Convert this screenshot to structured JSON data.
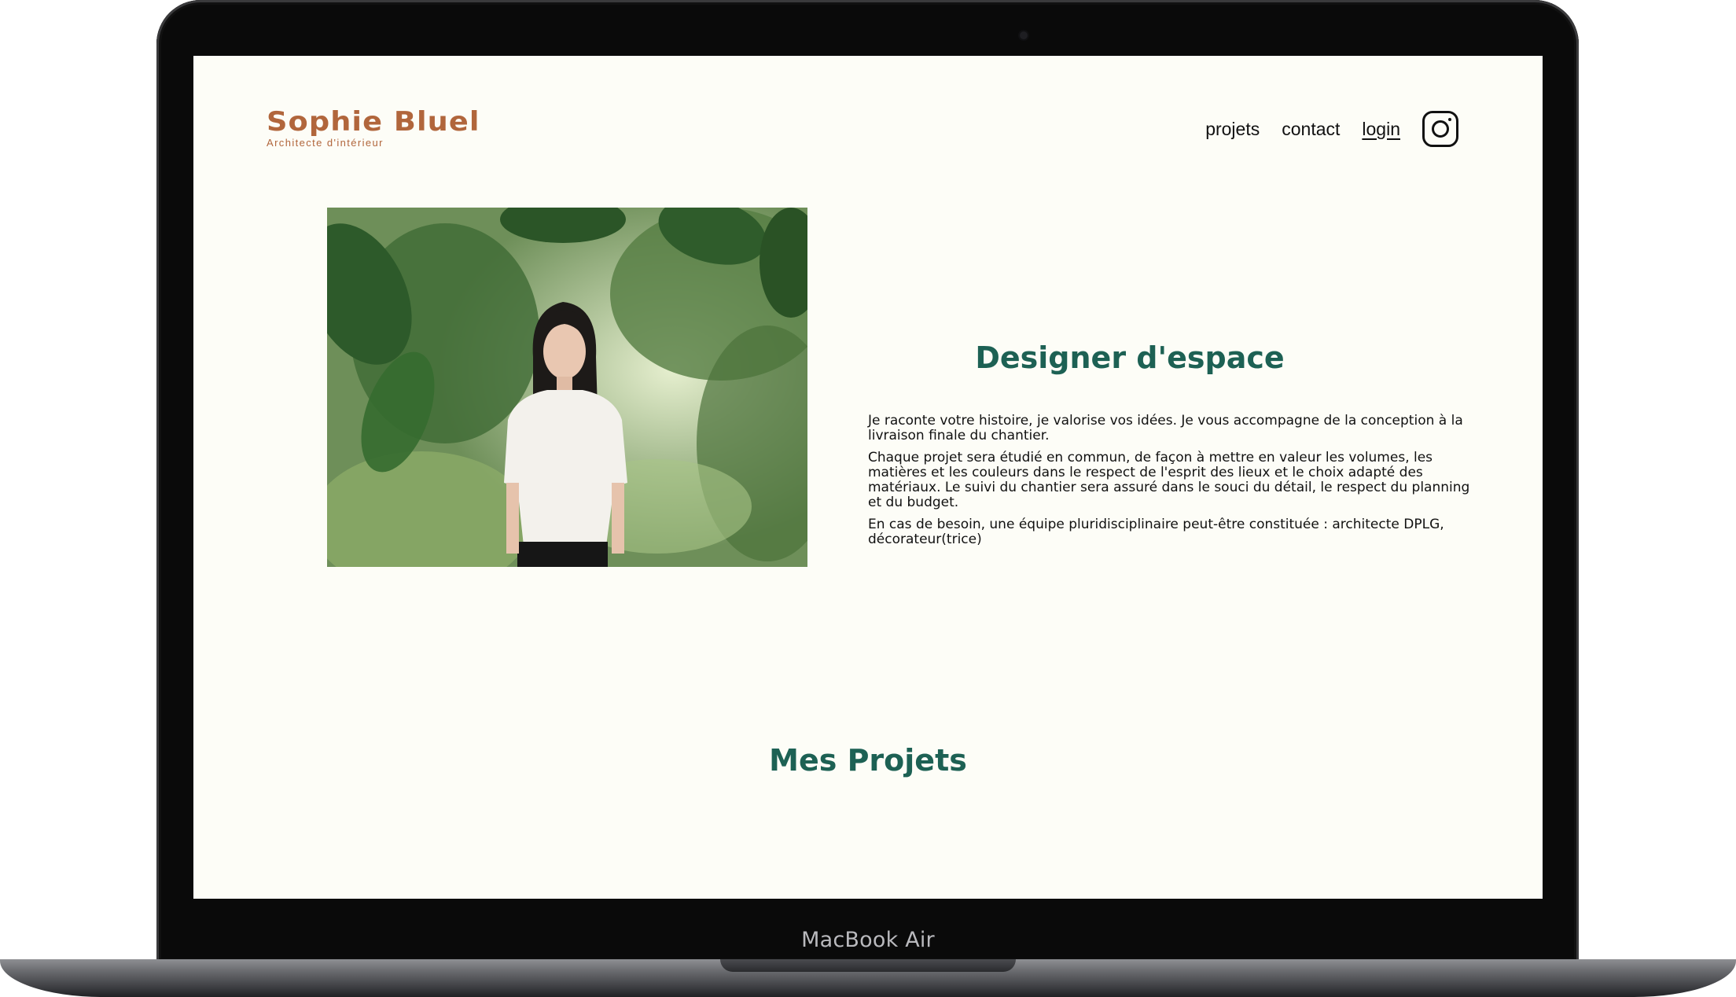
{
  "device": {
    "label": "MacBook Air"
  },
  "header": {
    "logo_title": "Sophie Bluel",
    "logo_subtitle": "Architecte d'intérieur",
    "nav": {
      "projects": "projets",
      "contact": "contact",
      "login": "login"
    },
    "social_icon": "instagram-icon"
  },
  "intro": {
    "title": "Designer d'espace",
    "paragraphs": [
      "Je raconte votre histoire, je valorise vos idées. Je vous accompagne de la conception à la livraison finale du chantier.",
      "Chaque projet sera étudié en commun, de façon à mettre en valeur les volumes, les matières et les couleurs dans le respect de l'esprit des lieux et le choix adapté des matériaux. Le suivi du chantier sera assuré dans le souci du détail, le respect du planning et du budget.",
      "En cas de besoin, une équipe pluridisciplinaire peut-être constituée : architecte DPLG, décorateur(trice)"
    ]
  },
  "portfolio": {
    "title": "Mes Projets"
  },
  "colors": {
    "accent": "#1d6154",
    "brand": "#b1663c",
    "background": "#fdfdf7"
  }
}
